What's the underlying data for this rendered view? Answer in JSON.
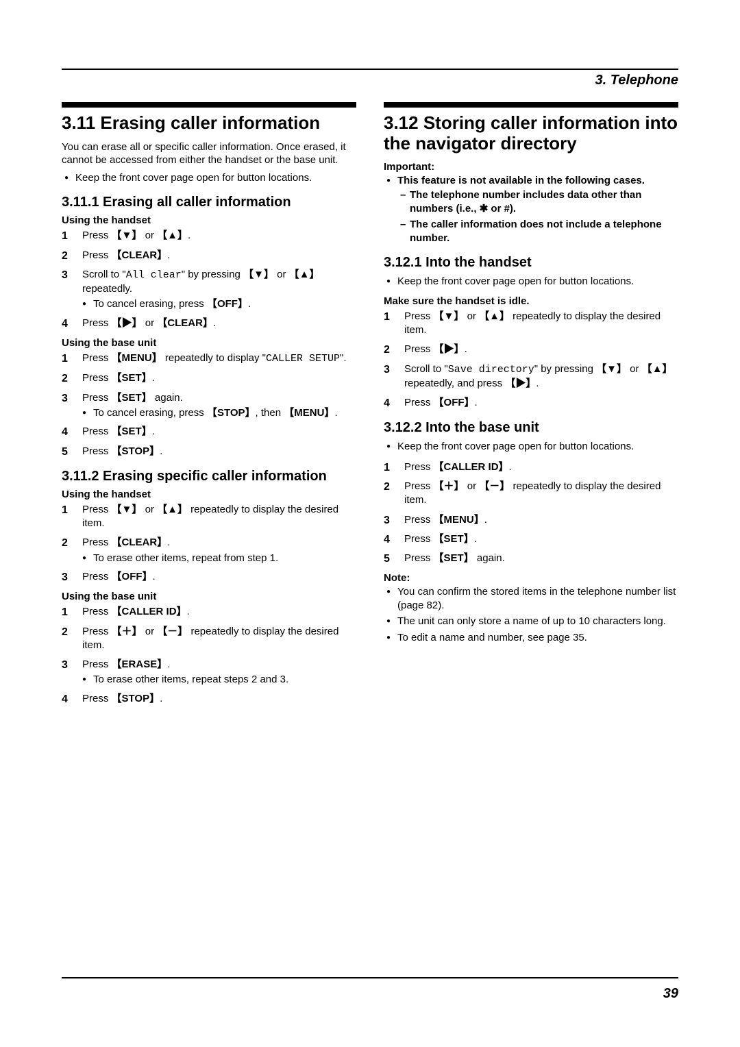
{
  "chapter": "3. Telephone",
  "page_number": "39",
  "left": {
    "sec_num_title": "3.11 Erasing caller information",
    "intro": "You can erase all or specific caller information. Once erased, it cannot be accessed from either the handset or the base unit.",
    "intro_bullet": "Keep the front cover page open for button locations.",
    "sub1_title": "3.11.1 Erasing all caller information",
    "sub1_handset_label": "Using the handset",
    "sub1_h_step1_a": "Press ",
    "sub1_h_step1_b": " or ",
    "sub1_h_step1_c": ".",
    "sub1_h_step2_a": "Press ",
    "sub1_h_step2_key": "CLEAR",
    "sub1_h_step2_b": ".",
    "sub1_h_step3_a": "Scroll to \"",
    "sub1_h_step3_mono": "All clear",
    "sub1_h_step3_b": "\" by pressing ",
    "sub1_h_step3_c": " or ",
    "sub1_h_step3_d": " repeatedly.",
    "sub1_h_step3_bullet_a": "To cancel erasing, press ",
    "sub1_h_step3_bullet_key": "OFF",
    "sub1_h_step3_bullet_b": ".",
    "sub1_h_step4_a": "Press ",
    "sub1_h_step4_b": " or ",
    "sub1_h_step4_key": "CLEAR",
    "sub1_h_step4_c": ".",
    "sub1_base_label": "Using the base unit",
    "sub1_b_step1_a": "Press ",
    "sub1_b_step1_key": "MENU",
    "sub1_b_step1_b": " repeatedly to display \"",
    "sub1_b_step1_mono": "CALLER SETUP",
    "sub1_b_step1_c": "\".",
    "sub1_b_step2_a": "Press ",
    "sub1_b_step2_key": "SET",
    "sub1_b_step2_b": ".",
    "sub1_b_step3_a": "Press ",
    "sub1_b_step3_key": "SET",
    "sub1_b_step3_b": " again.",
    "sub1_b_step3_bullet_a": "To cancel erasing, press ",
    "sub1_b_step3_bullet_key1": "STOP",
    "sub1_b_step3_bullet_b": ", then ",
    "sub1_b_step3_bullet_key2": "MENU",
    "sub1_b_step3_bullet_c": ".",
    "sub1_b_step4_a": "Press ",
    "sub1_b_step4_key": "SET",
    "sub1_b_step4_b": ".",
    "sub1_b_step5_a": "Press ",
    "sub1_b_step5_key": "STOP",
    "sub1_b_step5_b": ".",
    "sub2_title": "3.11.2 Erasing specific caller information",
    "sub2_handset_label": "Using the handset",
    "sub2_h_step1_a": "Press ",
    "sub2_h_step1_b": " or ",
    "sub2_h_step1_c": " repeatedly to display the desired item.",
    "sub2_h_step2_a": "Press ",
    "sub2_h_step2_key": "CLEAR",
    "sub2_h_step2_b": ".",
    "sub2_h_step2_bullet": "To erase other items, repeat from step 1.",
    "sub2_h_step3_a": "Press ",
    "sub2_h_step3_key": "OFF",
    "sub2_h_step3_b": ".",
    "sub2_base_label": "Using the base unit",
    "sub2_b_step1_a": "Press ",
    "sub2_b_step1_key": "CALLER ID",
    "sub2_b_step1_b": ".",
    "sub2_b_step2_a": "Press ",
    "sub2_b_step2_b": " or ",
    "sub2_b_step2_c": " repeatedly to display the desired item.",
    "sub2_b_step3_a": "Press ",
    "sub2_b_step3_key": "ERASE",
    "sub2_b_step3_b": ".",
    "sub2_b_step3_bullet": "To erase other items, repeat steps 2 and 3.",
    "sub2_b_step4_a": "Press ",
    "sub2_b_step4_key": "STOP",
    "sub2_b_step4_b": "."
  },
  "right": {
    "sec_num_title": "3.12 Storing caller information into the navigator directory",
    "important_label": "Important:",
    "important_bullet": "This feature is not available in the following cases.",
    "important_dash1": "The telephone number includes data other than numbers (i.e., ✱ or #).",
    "important_dash2": "The caller information does not include a telephone number.",
    "sub1_title": "3.12.1 Into the handset",
    "sub1_bullet": "Keep the front cover page open for button locations.",
    "sub1_idle": "Make sure the handset is idle.",
    "sub1_step1_a": "Press ",
    "sub1_step1_b": " or ",
    "sub1_step1_c": " repeatedly to display the desired item.",
    "sub1_step2_a": "Press ",
    "sub1_step2_b": ".",
    "sub1_step3_a": "Scroll to \"",
    "sub1_step3_mono": "Save directory",
    "sub1_step3_b": "\" by pressing ",
    "sub1_step3_c": " or ",
    "sub1_step3_d": " repeatedly, and press ",
    "sub1_step3_e": ".",
    "sub1_step4_a": "Press ",
    "sub1_step4_key": "OFF",
    "sub1_step4_b": ".",
    "sub2_title": "3.12.2 Into the base unit",
    "sub2_bullet": "Keep the front cover page open for button locations.",
    "sub2_step1_a": "Press ",
    "sub2_step1_key": "CALLER ID",
    "sub2_step1_b": ".",
    "sub2_step2_a": "Press ",
    "sub2_step2_b": " or ",
    "sub2_step2_c": " repeatedly to display the desired item.",
    "sub2_step3_a": "Press ",
    "sub2_step3_key": "MENU",
    "sub2_step3_b": ".",
    "sub2_step4_a": "Press ",
    "sub2_step4_key": "SET",
    "sub2_step4_b": ".",
    "sub2_step5_a": "Press ",
    "sub2_step5_key": "SET",
    "sub2_step5_b": " again.",
    "note_label": "Note:",
    "note1": "You can confirm the stored items in the telephone number list (page 82).",
    "note2": "The unit can only store a name of up to 10 characters long.",
    "note3": "To edit a name and number, see page 35."
  },
  "glyphs": {
    "down": "▼",
    "up": "▲",
    "right": "▶",
    "plus": "＋",
    "minus": "－"
  }
}
